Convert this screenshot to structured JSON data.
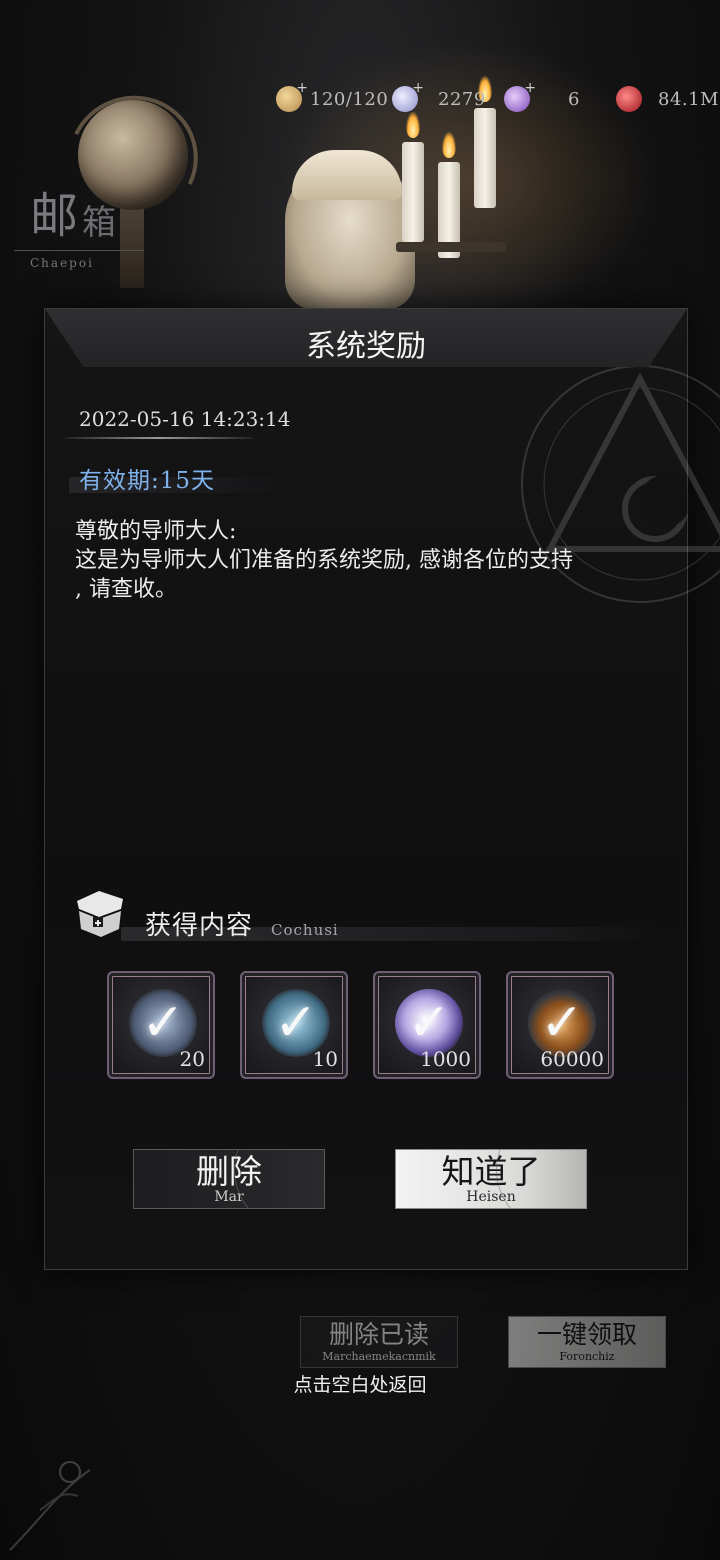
{
  "resources": [
    {
      "name": "stamina",
      "icon": "scroll-icon",
      "value": "120/120",
      "color": "#c9a45c"
    },
    {
      "name": "crystal",
      "icon": "crystal-icon",
      "value": "2279",
      "color": "#b9b9e8"
    },
    {
      "name": "purple-gem",
      "icon": "gem-icon",
      "value": "6",
      "color": "#9b6fd0"
    },
    {
      "name": "red-gem",
      "icon": "ruby-icon",
      "value": "84.1M",
      "color": "#c0262d"
    }
  ],
  "mailbox": {
    "title_big": "邮",
    "title_small": "箱",
    "subtitle": "Chaepoi"
  },
  "mail": {
    "title": "系统奖励",
    "date": "2022-05-16 14:23:14",
    "expiry": "有效期:15天",
    "body_lines": [
      "尊敬的导师大人:",
      "这是为导师大人们准备的系统奖励, 感谢各位的支持",
      ", 请查收。"
    ]
  },
  "rewards": {
    "label": "获得内容",
    "sublabel": "Cochusi",
    "items": [
      {
        "name": "scroll-item",
        "qty": "20",
        "color": "#8fa6c7"
      },
      {
        "name": "crystal-item",
        "qty": "10",
        "color": "#7fb1c8"
      },
      {
        "name": "diamond-item",
        "qty": "1000",
        "color": "#b9a7e3"
      },
      {
        "name": "food-item",
        "qty": "60000",
        "color": "#c98a44"
      }
    ]
  },
  "buttons": {
    "delete": {
      "label": "删除",
      "sub": "Mar"
    },
    "ok": {
      "label": "知道了",
      "sub": "Heisen"
    },
    "delete_read": {
      "label": "删除已读",
      "sub": "Marchaemekacnmik"
    },
    "claim_all": {
      "label": "一键领取",
      "sub": "Foronchiz"
    }
  },
  "tap_back": "点击空白处返回",
  "colors": {
    "accent_blue": "#7fb2ea",
    "panel": "#121213",
    "frame_purple": "#9a7e8e"
  }
}
